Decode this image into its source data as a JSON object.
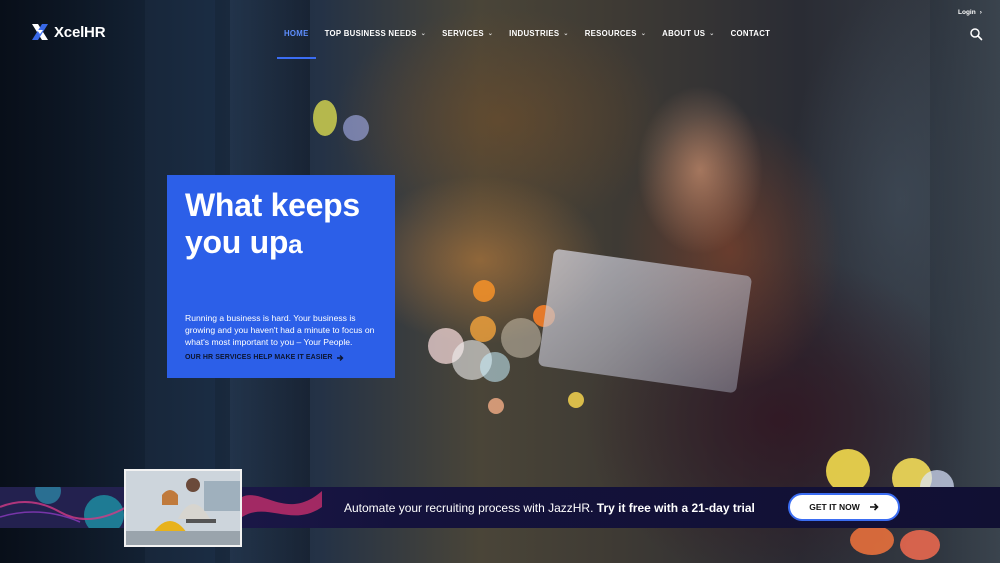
{
  "brand": {
    "name": "XcelHR"
  },
  "header": {
    "login_label": "Login",
    "nav": [
      {
        "label": "HOME",
        "active": true,
        "has_caret": false
      },
      {
        "label": "TOP BUSINESS NEEDS",
        "has_caret": true
      },
      {
        "label": "SERVICES",
        "has_caret": true
      },
      {
        "label": "INDUSTRIES",
        "has_caret": true
      },
      {
        "label": "RESOURCES",
        "has_caret": true
      },
      {
        "label": "ABOUT US",
        "has_caret": true
      },
      {
        "label": "CONTACT",
        "has_caret": false
      }
    ],
    "search_icon": "search-icon"
  },
  "hero": {
    "title": "What keeps you up",
    "title_cursor": "a",
    "body": "Running a business is hard. Your business is growing and you haven't had a minute to focus on what's most important to you – Your People.",
    "link_label": "OUR HR SERVICES HELP MAKE IT EASIER"
  },
  "banner": {
    "text_regular": "Automate your recruiting process with JazzHR.",
    "text_bold": "Try it free with a 21-day trial",
    "cta_label": "GET IT NOW"
  },
  "colors": {
    "accent": "#2c5fe8",
    "nav_active": "#5e8fff",
    "banner_bg": "#14123c"
  }
}
